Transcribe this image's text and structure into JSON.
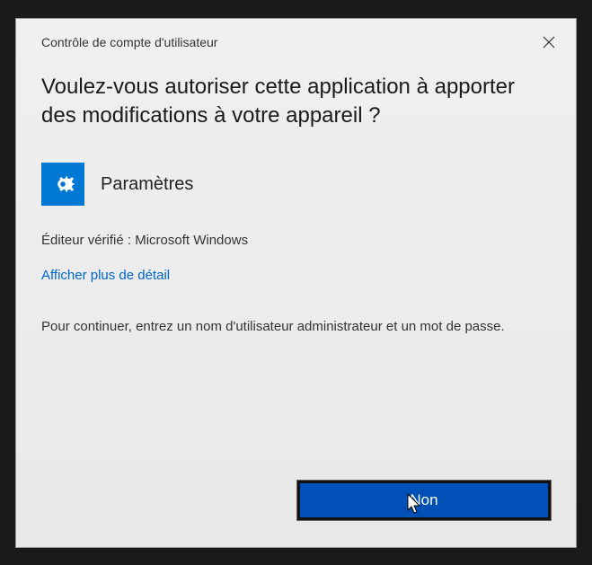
{
  "dialog": {
    "title": "Contrôle de compte d'utilisateur",
    "question": "Voulez-vous autoriser cette application à apporter des modifications à votre appareil ?",
    "app_name": "Paramètres",
    "publisher_line": "Éditeur vérifié : Microsoft Windows",
    "details_link": "Afficher plus de détail",
    "instruction": "Pour continuer, entrez un nom d'utilisateur administrateur et un mot de passe.",
    "no_button": "Non"
  },
  "icons": {
    "app": "gear-icon",
    "close": "close-icon"
  },
  "colors": {
    "accent": "#0078d4",
    "button_bg": "#0050b8",
    "link": "#0066cc"
  }
}
